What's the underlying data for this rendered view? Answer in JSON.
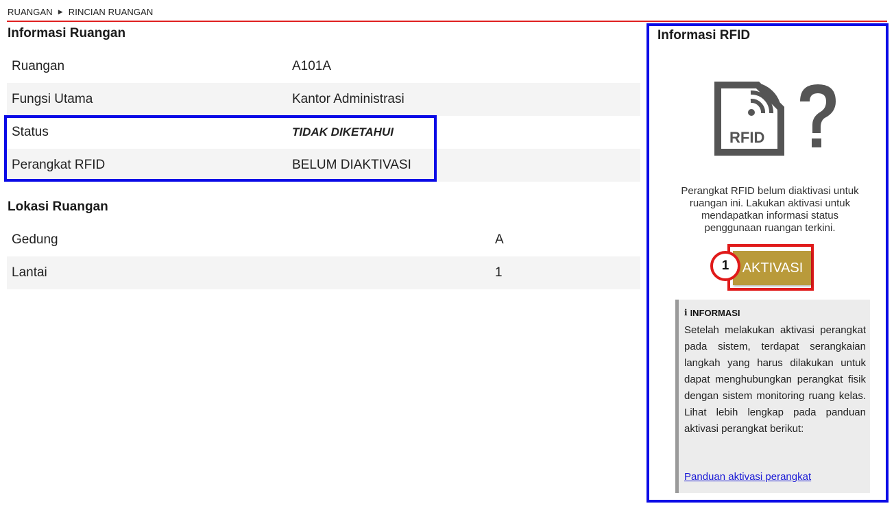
{
  "breadcrumb": {
    "root": "RUANGAN",
    "current": "RINCIAN RUANGAN"
  },
  "room_info": {
    "title": "Informasi Ruangan",
    "rows": [
      {
        "label": "Ruangan",
        "value": "A101A"
      },
      {
        "label": "Fungsi Utama",
        "value": "Kantor Administrasi"
      },
      {
        "label": "Status",
        "value": "TIDAK DIKETAHUI"
      },
      {
        "label": "Perangkat RFID",
        "value": "BELUM DIAKTIVASI"
      }
    ]
  },
  "location": {
    "title": "Lokasi Ruangan",
    "rows": [
      {
        "label": "Gedung",
        "value": "A"
      },
      {
        "label": "Lantai",
        "value": "1"
      }
    ]
  },
  "rfid": {
    "title": "Informasi RFID",
    "graphic_label": "RFID",
    "graphic_icon": "rfid-question-icon",
    "description": "Perangkat RFID belum diaktivasi untuk ruangan ini. Lakukan aktivasi untuk mendapatkan informasi status penggunaan ruangan terkini.",
    "activate_label": "AKTIVASI",
    "step_number": "1",
    "info": {
      "heading": "INFORMASI",
      "icon": "info-icon",
      "body": "Setelah melakukan aktivasi perangkat pada sistem, terdapat serangkaian langkah yang harus dilakukan untuk dapat menghubungkan perangkat fisik dengan sistem monitoring ruang kelas. Lihat lebih lengkap pada panduan aktivasi perangkat berikut:",
      "link": "Panduan aktivasi perangkat"
    }
  },
  "colors": {
    "accent_red": "#e02020",
    "highlight_blue": "#0a0ae6",
    "button_gold": "#b99a3a",
    "link_blue": "#1a1ad6"
  }
}
